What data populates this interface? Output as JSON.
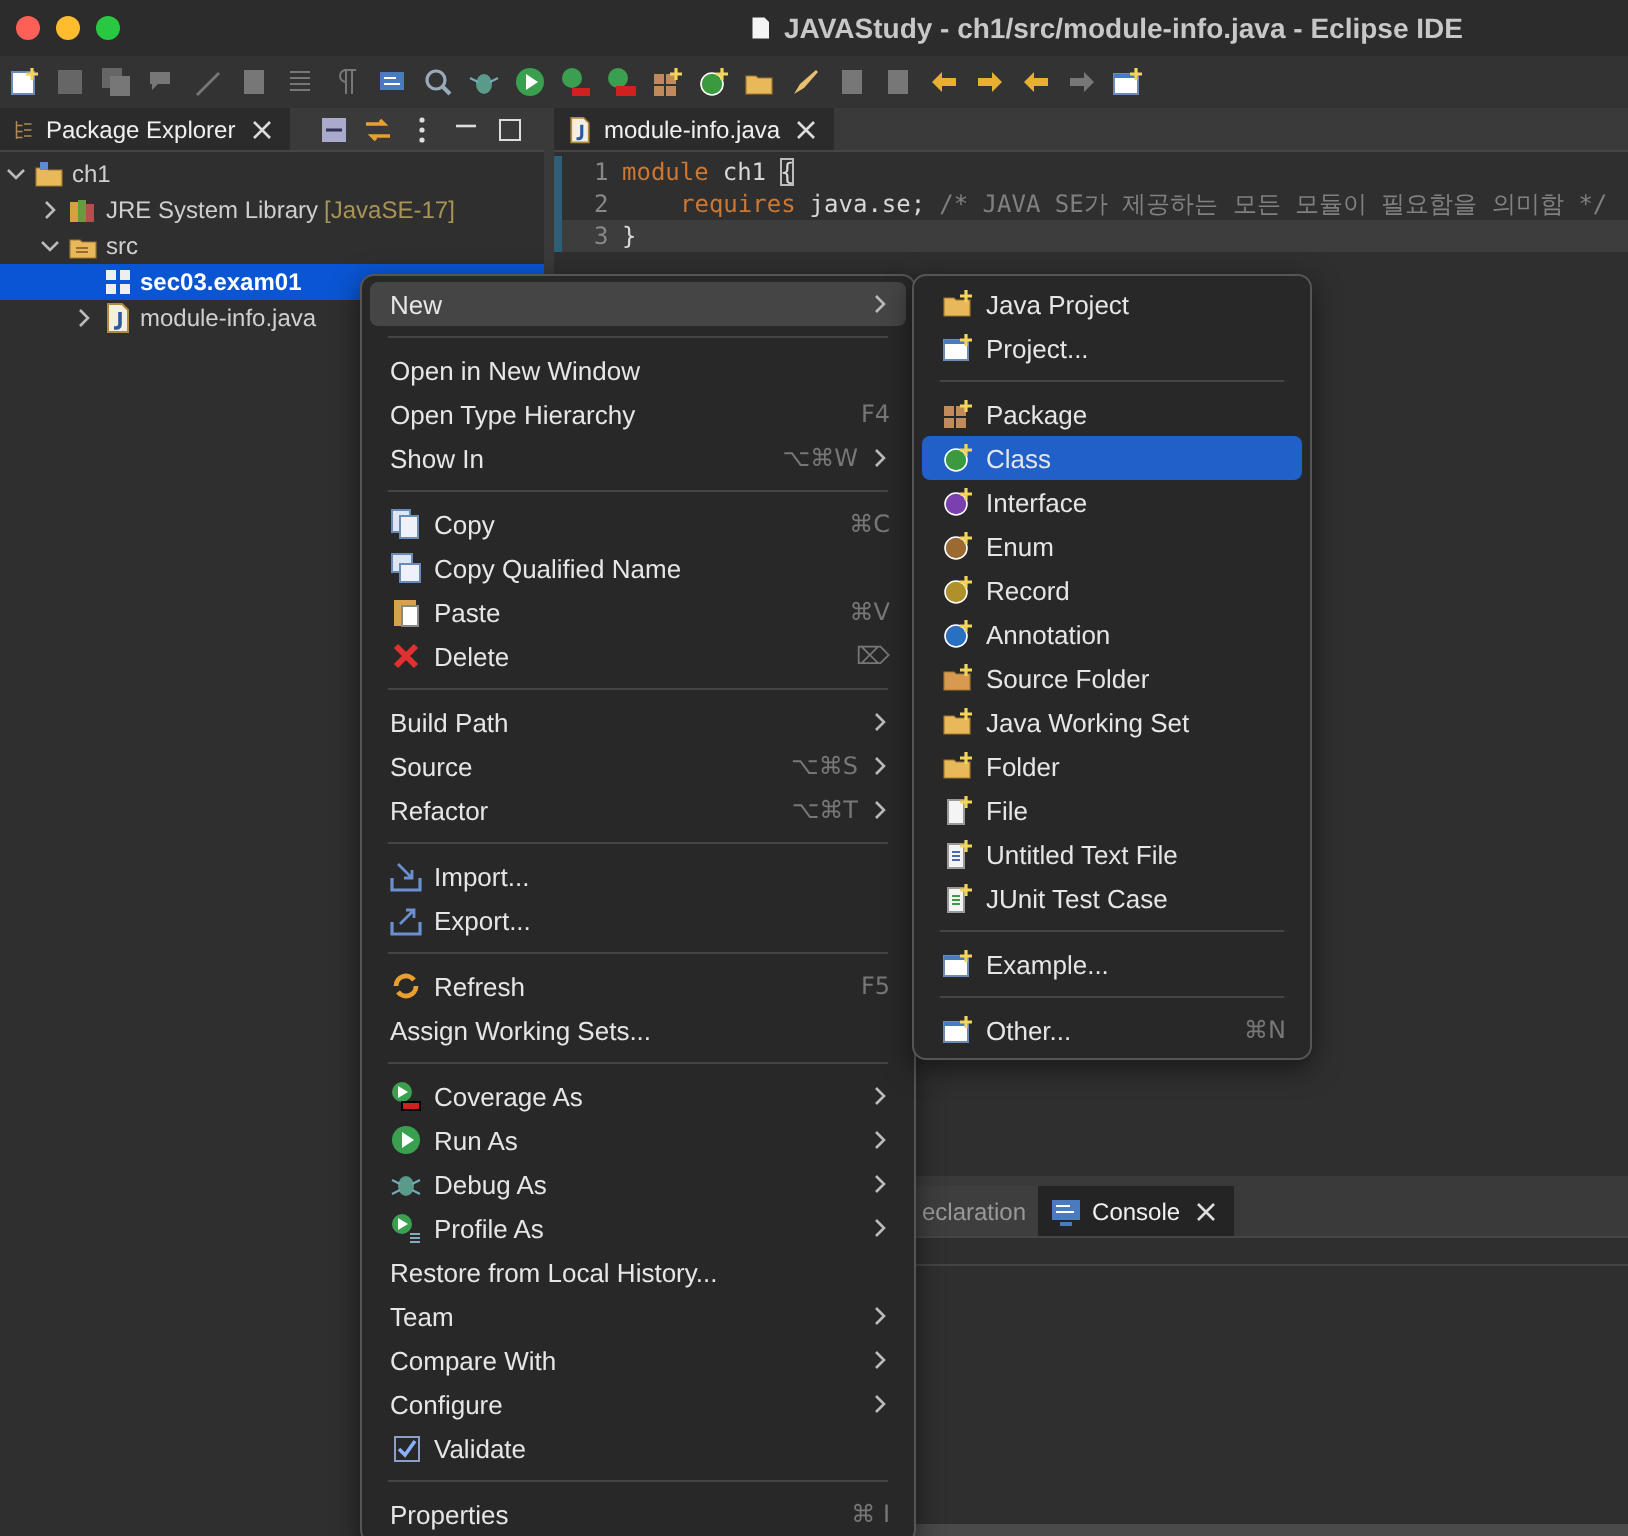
{
  "window": {
    "title": "JAVAStudy - ch1/src/module-info.java - Eclipse IDE"
  },
  "package_explorer": {
    "tab": {
      "label": "Package Explorer",
      "selected": true
    },
    "tree": [
      {
        "label": "ch1",
        "kind": "project",
        "expanded": true,
        "selected": false,
        "children": [
          {
            "label": "JRE System Library",
            "decoration": "[JavaSE-17]",
            "kind": "library",
            "expanded": false,
            "selected": false
          },
          {
            "label": "src",
            "kind": "source-folder",
            "expanded": true,
            "selected": false,
            "children": [
              {
                "label": "sec03.exam01",
                "kind": "package",
                "selected": true
              },
              {
                "label": "module-info.java",
                "kind": "java-file",
                "expanded": false,
                "selected": false
              }
            ]
          }
        ]
      }
    ]
  },
  "editor": {
    "tab": {
      "label": "module-info.java",
      "selected": true
    },
    "lines": [
      {
        "number": "1",
        "indented": false,
        "current": false,
        "tokens": [
          {
            "kind": "keyword",
            "text": "module"
          },
          {
            "kind": "plain",
            "text": "ch1"
          },
          {
            "kind": "bracket-match",
            "text": "{"
          }
        ]
      },
      {
        "number": "2",
        "indented": true,
        "current": false,
        "tokens": [
          {
            "kind": "keyword",
            "text": "requires"
          },
          {
            "kind": "plain",
            "text": "java.se;"
          },
          {
            "kind": "comment",
            "text": "/* JAVA SE가 제공하는 모든 모듈이 필요함을 의미함 */"
          }
        ]
      },
      {
        "number": "3",
        "indented": false,
        "current": true,
        "tokens": [
          {
            "kind": "plain",
            "text": "}"
          }
        ]
      }
    ]
  },
  "bottom_panel": {
    "tabs": [
      {
        "label": "eclaration",
        "selected": false
      },
      {
        "label": "Console",
        "selected": true
      }
    ]
  },
  "context_menu": {
    "groups": [
      [
        {
          "label": "New",
          "submenu": true,
          "selected": true
        }
      ],
      [
        {
          "label": "Open in New Window",
          "submenu": false,
          "selected": false
        },
        {
          "label": "Open Type Hierarchy",
          "shortcut": "F4",
          "submenu": false,
          "selected": false
        },
        {
          "label": "Show In",
          "shortcut": "⌥⌘W",
          "submenu": true,
          "selected": false
        }
      ],
      [
        {
          "label": "Copy",
          "shortcut": "⌘C",
          "submenu": false,
          "selected": false
        },
        {
          "label": "Copy Qualified Name",
          "submenu": false,
          "selected": false
        },
        {
          "label": "Paste",
          "shortcut": "⌘V",
          "submenu": false,
          "selected": false
        },
        {
          "label": "Delete",
          "shortcut": "⌦",
          "submenu": false,
          "selected": false
        }
      ],
      [
        {
          "label": "Build Path",
          "submenu": true,
          "selected": false
        },
        {
          "label": "Source",
          "shortcut": "⌥⌘S",
          "submenu": true,
          "selected": false
        },
        {
          "label": "Refactor",
          "shortcut": "⌥⌘T",
          "submenu": true,
          "selected": false
        }
      ],
      [
        {
          "label": "Import...",
          "submenu": false,
          "selected": false
        },
        {
          "label": "Export...",
          "submenu": false,
          "selected": false
        }
      ],
      [
        {
          "label": "Refresh",
          "shortcut": "F5",
          "submenu": false,
          "selected": false
        },
        {
          "label": "Assign Working Sets...",
          "submenu": false,
          "selected": false
        }
      ],
      [
        {
          "label": "Coverage As",
          "submenu": true,
          "selected": false
        },
        {
          "label": "Run As",
          "submenu": true,
          "selected": false
        },
        {
          "label": "Debug As",
          "submenu": true,
          "selected": false
        },
        {
          "label": "Profile As",
          "submenu": true,
          "selected": false
        },
        {
          "label": "Restore from Local History...",
          "submenu": false,
          "selected": false
        },
        {
          "label": "Team",
          "submenu": true,
          "selected": false
        },
        {
          "label": "Compare With",
          "submenu": true,
          "selected": false
        },
        {
          "label": "Configure",
          "submenu": true,
          "selected": false
        },
        {
          "label": "Validate",
          "kind": "check",
          "checked": true,
          "submenu": false,
          "selected": false
        }
      ],
      [
        {
          "label": "Properties",
          "shortcut": "⌘ I",
          "submenu": false,
          "selected": false
        }
      ]
    ]
  },
  "new_submenu": {
    "groups": [
      [
        {
          "label": "Java Project",
          "selected": false
        },
        {
          "label": "Project...",
          "selected": false
        }
      ],
      [
        {
          "label": "Package",
          "selected": false
        },
        {
          "label": "Class",
          "selected": true
        },
        {
          "label": "Interface",
          "selected": false
        },
        {
          "label": "Enum",
          "selected": false
        },
        {
          "label": "Record",
          "selected": false
        },
        {
          "label": "Annotation",
          "selected": false
        },
        {
          "label": "Source Folder",
          "selected": false
        },
        {
          "label": "Java Working Set",
          "selected": false
        },
        {
          "label": "Folder",
          "selected": false
        },
        {
          "label": "File",
          "selected": false
        },
        {
          "label": "Untitled Text File",
          "selected": false
        },
        {
          "label": "JUnit Test Case",
          "selected": false
        }
      ],
      [
        {
          "label": "Example...",
          "selected": false
        }
      ],
      [
        {
          "label": "Other...",
          "shortcut": "⌘N",
          "selected": false
        }
      ]
    ]
  }
}
